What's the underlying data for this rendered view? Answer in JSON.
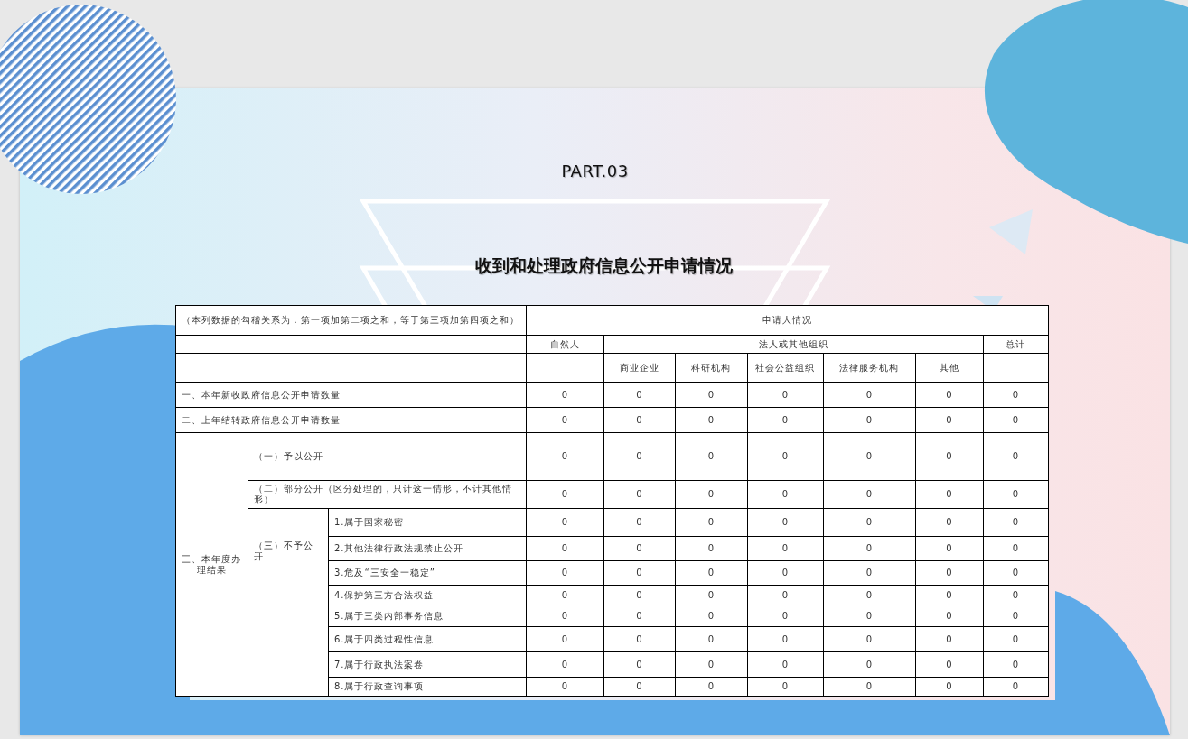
{
  "part_label": "PART.03",
  "title": "收到和处理政府信息公开申请情况",
  "table": {
    "note": "（本列数据的勾稽关系为：第一项加第二项之和，等于第三项加第四项之和）",
    "applicant": "申请人情况",
    "natural_person": "自然人",
    "legal_entities": "法人或其他组织",
    "total": "总计",
    "subcolumns": [
      "商业企业",
      "科研机构",
      "社会公益组织",
      "法律服务机构",
      "其他"
    ],
    "top_rows": [
      {
        "label": "一、本年新收政府信息公开申请数量",
        "values": [
          "0",
          "0",
          "0",
          "0",
          "0",
          "0",
          "0"
        ]
      },
      {
        "label": "二、上年结转政府信息公开申请数量",
        "values": [
          "0",
          "0",
          "0",
          "0",
          "0",
          "0",
          "0"
        ]
      }
    ],
    "results": {
      "label": "三、本年度办理结果",
      "items": [
        {
          "label": "（一）予以公开",
          "values": [
            "0",
            "0",
            "0",
            "0",
            "0",
            "0",
            "0"
          ]
        },
        {
          "label": "（二）部分公开（区分处理的，只计这一情形，不计其他情形）",
          "values": [
            "0",
            "0",
            "0",
            "0",
            "0",
            "0",
            "0"
          ]
        }
      ],
      "not_disclosed": {
        "label": "（三）不予公开",
        "items": [
          {
            "label": "1.属于国家秘密",
            "values": [
              "0",
              "0",
              "0",
              "0",
              "0",
              "0",
              "0"
            ]
          },
          {
            "label": "2.其他法律行政法规禁止公开",
            "values": [
              "0",
              "0",
              "0",
              "0",
              "0",
              "0",
              "0"
            ]
          },
          {
            "label": "3.危及“三安全一稳定”",
            "values": [
              "0",
              "0",
              "0",
              "0",
              "0",
              "0",
              "0"
            ]
          },
          {
            "label": "4.保护第三方合法权益",
            "values": [
              "0",
              "0",
              "0",
              "0",
              "0",
              "0",
              "0"
            ]
          },
          {
            "label": "5.属于三类内部事务信息",
            "values": [
              "0",
              "0",
              "0",
              "0",
              "0",
              "0",
              "0"
            ]
          },
          {
            "label": "6.属于四类过程性信息",
            "values": [
              "0",
              "0",
              "0",
              "0",
              "0",
              "0",
              "0"
            ]
          },
          {
            "label": "7.属于行政执法案卷",
            "values": [
              "0",
              "0",
              "0",
              "0",
              "0",
              "0",
              "0"
            ]
          },
          {
            "label": "8.属于行政查询事项",
            "values": [
              "0",
              "0",
              "0",
              "0",
              "0",
              "0",
              "0"
            ]
          }
        ]
      }
    }
  }
}
